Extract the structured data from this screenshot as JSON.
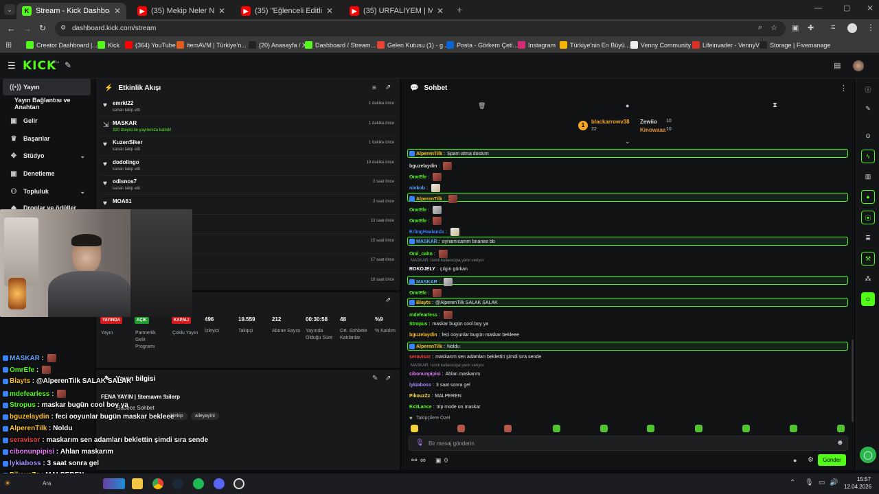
{
  "browser": {
    "tabs": [
      {
        "title": "Stream - Kick Dashboard",
        "fav": "K",
        "favColor": "#53fc18",
        "active": true
      },
      {
        "title": "(35) Mekip Neler Neler 62.Bölü",
        "fav": "▶",
        "favColor": "#ff0000",
        "active": false
      },
      {
        "title": "(35) \"Eğlenceli Editli Video\" Kic",
        "fav": "▶",
        "favColor": "#ff0000",
        "active": false
      },
      {
        "title": "(35) URFALİYEM | Madara Oldu",
        "fav": "▶",
        "favColor": "#ff0000",
        "active": false
      }
    ],
    "url": "dashboard.kick.com/stream",
    "bookmarks": [
      {
        "label": "Creator Dashboard |...",
        "color": "#53fc18"
      },
      {
        "label": "Kick",
        "color": "#53fc18"
      },
      {
        "label": "(364) YouTube",
        "color": "#ff0000"
      },
      {
        "label": "itemAVM | Türkiye'n...",
        "color": "#e25c1d"
      },
      {
        "label": "(20) Anasayfa / X",
        "color": "#222222"
      },
      {
        "label": "Dashboard / Stream...",
        "color": "#53fc18"
      },
      {
        "label": "Gelen Kutusu (1) - g...",
        "color": "#ea4335"
      },
      {
        "label": "Posta - Görkem Çeti...",
        "color": "#0a64d6"
      },
      {
        "label": "Instagram",
        "color": "#d62976"
      },
      {
        "label": "Türkiye'nin En Büyü...",
        "color": "#f5b400"
      },
      {
        "label": "Venny Community",
        "color": "#eeeeee"
      },
      {
        "label": "Lifeinvader - VennyV",
        "color": "#d93025"
      },
      {
        "label": "Storage | Fivemanage",
        "color": "#222222"
      }
    ]
  },
  "kick": {
    "logo": "KICK",
    "beta": "BETA"
  },
  "sidebar": {
    "items": [
      {
        "label": "Yayın",
        "icon": "broadcast-icon",
        "glyph": "((•))"
      },
      {
        "label": "Yayın Bağlantısı ve Anahtarı",
        "icon": "",
        "glyph": ""
      },
      {
        "label": "Gelir",
        "icon": "money-icon",
        "glyph": "▣"
      },
      {
        "label": "Başarılar",
        "icon": "trophy-icon",
        "glyph": "♛"
      },
      {
        "label": "Stüdyo",
        "icon": "studio-icon",
        "glyph": "✥"
      },
      {
        "label": "Denetleme",
        "icon": "moderation-icon",
        "glyph": "▣"
      },
      {
        "label": "Topluluk",
        "icon": "community-icon",
        "glyph": "⚇"
      },
      {
        "label": "Droplar ve ödüller",
        "icon": "drops-icon",
        "glyph": "◆"
      }
    ]
  },
  "activity": {
    "title": "Etkinlik Akışı",
    "items": [
      {
        "user": "emrkl22",
        "sub": "kanalı takip etti",
        "time": "1 dakika önce",
        "icon": "♥"
      },
      {
        "user": "MASKAR",
        "sub": "320 izleyici ile yayınınıza katıldı!",
        "time": "1 dakika önce",
        "icon": "⇲"
      },
      {
        "user": "KuzenSiker",
        "sub": "kanalı takip etti",
        "time": "1 dakika önce",
        "icon": "♥"
      },
      {
        "user": "dodolingo",
        "sub": "kanalı takip etti",
        "time": "19 dakika önce",
        "icon": "♥"
      },
      {
        "user": "odisnos7",
        "sub": "kanalı takip etti",
        "time": "3 saat önce",
        "icon": "♥"
      },
      {
        "user": "MOA61",
        "sub": "",
        "time": "3 saat önce",
        "icon": "♥"
      },
      {
        "user": "",
        "sub": "",
        "time": "13 saat önce",
        "icon": ""
      },
      {
        "user": "",
        "sub": "",
        "time": "15 saat önce",
        "icon": ""
      },
      {
        "user": "",
        "sub": "",
        "time": "17 saat önce",
        "icon": ""
      },
      {
        "user": "",
        "sub": "",
        "time": "18 saat önce",
        "icon": ""
      }
    ]
  },
  "stats": {
    "badges": [
      {
        "text": "YAYINDA",
        "color": "#d5191c",
        "label": "Yayın"
      },
      {
        "text": "AÇIK",
        "color": "#1f9d2e",
        "label": "Partnerlik Gelir Programı"
      },
      {
        "text": "KAPALI",
        "color": "#d5191c",
        "label": "Çoklu Yayın"
      }
    ],
    "values": [
      {
        "value": "496",
        "label": "İzleyici"
      },
      {
        "value": "19.559",
        "label": "Takipçi"
      },
      {
        "value": "212",
        "label": "Abone Sayısı"
      },
      {
        "value": "00:30:58",
        "label": "Yayında Olduğu Süre"
      },
      {
        "value": "48",
        "label": "Ort. Sohbete Katılanlar"
      },
      {
        "value": "%9",
        "label": "% Katılım"
      }
    ]
  },
  "streaminfo": {
    "title": "Yayın bilgisi",
    "stream_title": "FENA YAYIN | !itemavm !bilerp",
    "chat_mode": "Sadece Sohbet",
    "tags": [
      "Mekip",
      "aileyayini"
    ]
  },
  "chat": {
    "title": "Sohbet",
    "leaderboard": [
      {
        "name": "blackarrowv38",
        "count": "22",
        "color": "#f5a524"
      },
      {
        "name": "Zewiio",
        "count": "10",
        "color": "#dddddd"
      },
      {
        "name": "Kinowaaa",
        "count": "10",
        "color": "#e0913a"
      }
    ],
    "input_placeholder": "Bir mesaj gönderin",
    "send_label": "Gönder",
    "followers_only_label": "Takipçilere Özel",
    "footer_counts": [
      "∞",
      "0"
    ],
    "messages": [
      {
        "name": "AlperenTilk",
        "color": "#fbbf24",
        "text": "Spam atma dostum",
        "hl": true
      },
      {
        "name": "bguzelaydin",
        "color": "#dddddd",
        "text": "",
        "emote": "red"
      },
      {
        "name": "OmrEfe",
        "color": "#53fc18",
        "text": "",
        "emote": "red"
      },
      {
        "name": "ninkob",
        "color": "#60a5fa",
        "text": "",
        "emote": "pale"
      },
      {
        "name": "AlperenTilk",
        "color": "#fbbf24",
        "text": "",
        "emote": "red",
        "hl": true
      },
      {
        "name": "OmrEfe",
        "color": "#53fc18",
        "text": "",
        "emote": "gray"
      },
      {
        "name": "OmrEfe",
        "color": "#53fc18",
        "text": "",
        "emote": "red"
      },
      {
        "name": "ErlingHaalandx",
        "color": "#3b82f6",
        "text": "",
        "emote": "pale"
      },
      {
        "name": "MASKAR",
        "color": "#60a5fa",
        "text": "oynamıcamm bnanee bb",
        "hl": true
      },
      {
        "name": "Onii_cahn",
        "color": "#53fc18",
        "text": "",
        "emote": "red"
      },
      {
        "name": "ROKOJELY",
        "color": "#ffffff",
        "text": "çılgın gürkan",
        "reply": "MASKAR: İsimli kullanıcıya yanıt veriyor"
      },
      {
        "name": "MASKAR",
        "color": "#60a5fa",
        "text": "",
        "emote": "gray",
        "hl": true
      },
      {
        "name": "OmrEfe",
        "color": "#53fc18",
        "text": "",
        "emote": "red"
      },
      {
        "name": "Blayts",
        "color": "#fbbf24",
        "text": "@AlperenTilk SALAK SALAK",
        "hl": true
      },
      {
        "name": "mdefearless",
        "color": "#53fc18",
        "text": "",
        "emote": "red"
      },
      {
        "name": "Stropus",
        "color": "#53fc18",
        "text": "maskar bugün cool boy ya"
      },
      {
        "name": "bguzelaydin",
        "color": "#fbbf24",
        "text": "feci ooyunlar bugün maskar bekleee"
      },
      {
        "name": "AlperenTilk",
        "color": "#fbbf24",
        "text": "Noldu",
        "hl": true
      },
      {
        "name": "seravisor",
        "color": "#ef4444",
        "text": "maskarım sen adamları beklettin şimdi sıra sende"
      },
      {
        "name": "cibonunpipisi",
        "color": "#e879f9",
        "text": "Ahlan maskarım",
        "reply": "MASKAR: İsimli kullanıcıya yanıt veriyor"
      },
      {
        "name": "lykiaboss",
        "color": "#a78bfa",
        "text": "3 saat sonra gel"
      },
      {
        "name": "PikouzZz",
        "color": "#fde047",
        "text": "MALPEREN"
      },
      {
        "name": "Ex3Lance",
        "color": "#53fc18",
        "text": "trip mode on maskar"
      }
    ]
  },
  "overlay": {
    "lines": [
      {
        "name": "MASKAR",
        "color": "#60a5fa",
        "text": ""
      },
      {
        "name": "OmrEfe",
        "color": "#53fc18",
        "text": ""
      },
      {
        "name": "Blayts",
        "color": "#fbbf24",
        "text": "@AlperenTilk SALAK SALAK"
      },
      {
        "name": "mdefearless",
        "color": "#53fc18",
        "text": ""
      },
      {
        "name": "Stropus",
        "color": "#53fc18",
        "text": "maskar bugün cool boy ya"
      },
      {
        "name": "bguzelaydin",
        "color": "#fbbf24",
        "text": "feci ooyunlar bugün maskar bekleee"
      },
      {
        "name": "AlperenTilk",
        "color": "#fbbf24",
        "text": "Noldu"
      },
      {
        "name": "seravisor",
        "color": "#ef4444",
        "text": "maskarım sen adamları beklettin şimdi sıra sende"
      },
      {
        "name": "cibonunpipisi",
        "color": "#e879f9",
        "text": "Ahlan maskarım"
      },
      {
        "name": "lykiaboss",
        "color": "#a78bfa",
        "text": "3 saat sonra gel"
      },
      {
        "name": "PikouzZz",
        "color": "#fde047",
        "text": "MALPEREN"
      },
      {
        "name": "Ex3Lance",
        "color": "#53fc18",
        "text": "trip mode on maskar"
      }
    ]
  },
  "taskbar": {
    "search": "Ara",
    "time": "15:57",
    "date": "12.04.2026"
  }
}
